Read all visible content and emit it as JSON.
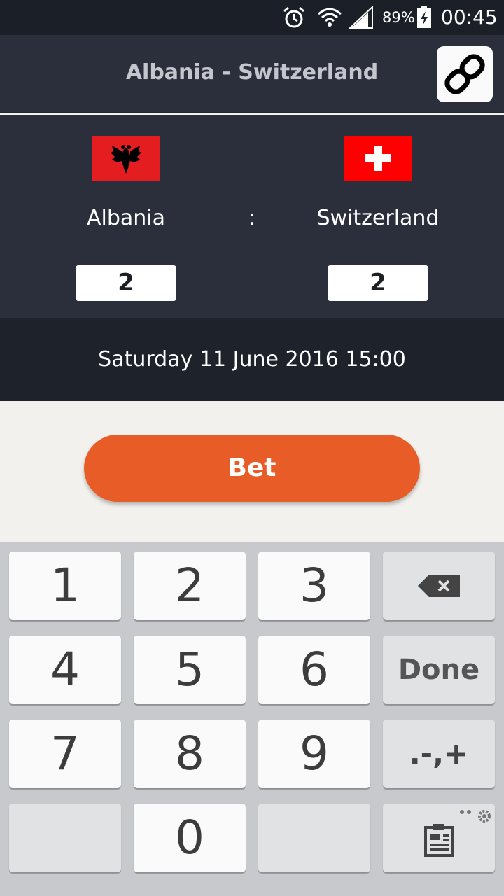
{
  "status_bar": {
    "battery_percent": "89%",
    "time": "00:45",
    "icons": [
      "alarm-icon",
      "wifi-icon",
      "signal-icon",
      "battery-charging-icon"
    ]
  },
  "header": {
    "title": "Albania - Switzerland",
    "link_icon": "link-chain-icon"
  },
  "match": {
    "home_team": "Albania",
    "away_team": "Switzerland",
    "separator": ":",
    "home_score": "2",
    "away_score": "2",
    "home_flag": "albania-flag",
    "away_flag": "switzerland-flag"
  },
  "datetime": "Saturday 11 June 2016 15:00",
  "bet_button": "Bet",
  "keyboard": {
    "keys": [
      "1",
      "2",
      "3",
      "4",
      "5",
      "6",
      "7",
      "8",
      "9",
      "0"
    ],
    "done_label": "Done",
    "symbols_label": ".-,+",
    "backspace_icon": "backspace-icon",
    "clipboard_icon": "clipboard-icon",
    "settings_icon": "settings-gear-icon"
  },
  "colors": {
    "header_bg": "#2a2f3b",
    "date_bg": "#1d222b",
    "bet_button": "#e85d27",
    "page_bg": "#f3f1ed",
    "keyboard_bg": "#c7c9cd"
  }
}
